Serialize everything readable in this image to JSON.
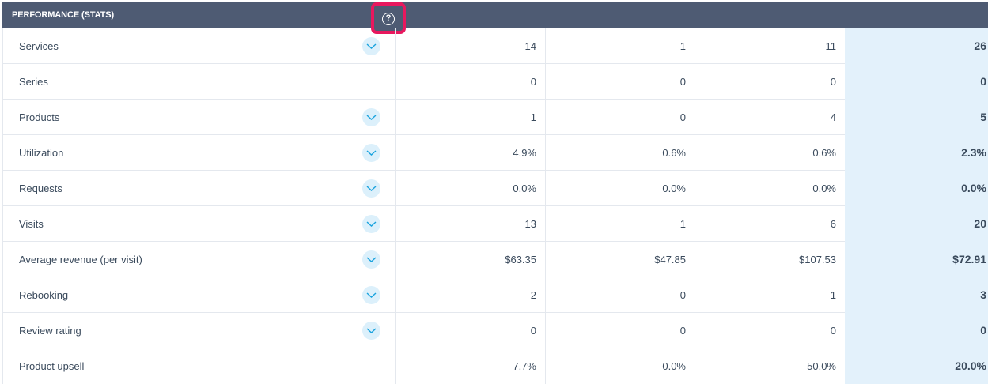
{
  "header": {
    "title": "PERFORMANCE (STATS)",
    "help_icon": "question-circle-icon"
  },
  "colors": {
    "header_bg": "#4e5b73",
    "highlight": "#e8185e",
    "total_bg": "#e3f1fb",
    "chevron_bg": "#dcf0fb",
    "chevron": "#1aa3de"
  },
  "rows": [
    {
      "label": "Services",
      "expandable": true,
      "values": [
        "14",
        "1",
        "11",
        "26"
      ]
    },
    {
      "label": "Series",
      "expandable": false,
      "values": [
        "0",
        "0",
        "0",
        "0"
      ]
    },
    {
      "label": "Products",
      "expandable": true,
      "values": [
        "1",
        "0",
        "4",
        "5"
      ]
    },
    {
      "label": "Utilization",
      "expandable": true,
      "values": [
        "4.9%",
        "0.6%",
        "0.6%",
        "2.3%"
      ]
    },
    {
      "label": "Requests",
      "expandable": true,
      "values": [
        "0.0%",
        "0.0%",
        "0.0%",
        "0.0%"
      ]
    },
    {
      "label": "Visits",
      "expandable": true,
      "values": [
        "13",
        "1",
        "6",
        "20"
      ]
    },
    {
      "label": "Average revenue (per visit)",
      "expandable": true,
      "values": [
        "$63.35",
        "$47.85",
        "$107.53",
        "$72.91"
      ]
    },
    {
      "label": "Rebooking",
      "expandable": true,
      "values": [
        "2",
        "0",
        "1",
        "3"
      ]
    },
    {
      "label": "Review rating",
      "expandable": true,
      "values": [
        "0",
        "0",
        "0",
        "0"
      ]
    },
    {
      "label": "Product upsell",
      "expandable": false,
      "values": [
        "7.7%",
        "0.0%",
        "50.0%",
        "20.0%"
      ]
    }
  ]
}
